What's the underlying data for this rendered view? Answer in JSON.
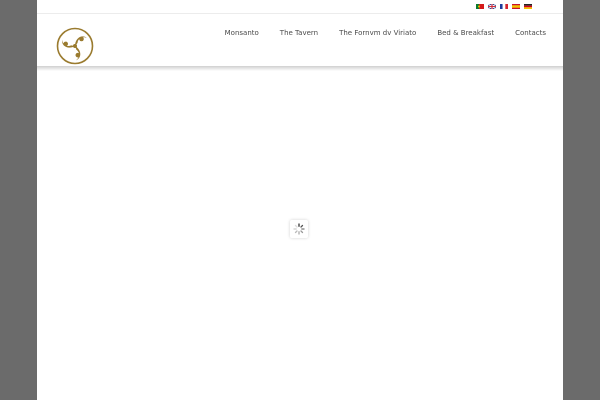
{
  "language_flags": [
    {
      "name": "portuguese-flag-icon",
      "lang": "pt"
    },
    {
      "name": "english-flag-icon",
      "lang": "en"
    },
    {
      "name": "french-flag-icon",
      "lang": "fr"
    },
    {
      "name": "spanish-flag-icon",
      "lang": "es"
    },
    {
      "name": "german-flag-icon",
      "lang": "de"
    }
  ],
  "logo": {
    "icon": "triskelion-logo-icon",
    "color": "#9a7b2f"
  },
  "nav": {
    "items": [
      {
        "label": "Monsanto"
      },
      {
        "label": "The Tavern"
      },
      {
        "label": "The Fornvm dv Viriato"
      },
      {
        "label": "Bed & Breakfast"
      },
      {
        "label": "Contacts"
      }
    ]
  },
  "loader": {
    "icon": "loading-spinner-icon"
  },
  "colors": {
    "background": "#6b6b6b",
    "page": "#ffffff",
    "nav_text": "#4a4a4a",
    "logo_gold": "#9a7b2f"
  }
}
